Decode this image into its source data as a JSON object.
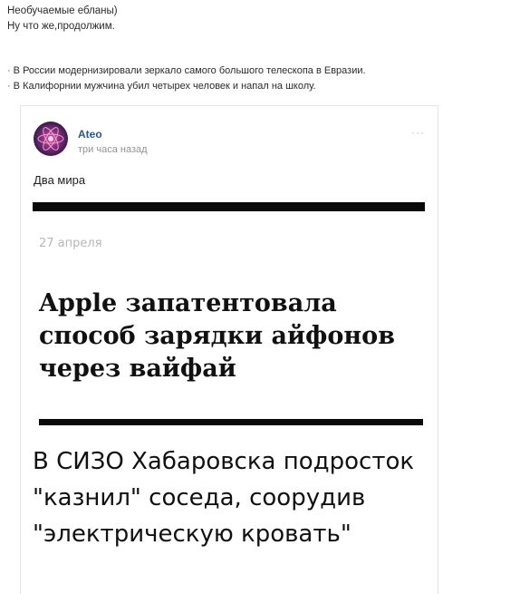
{
  "intro": {
    "line1": "Необучаемые ебланы)",
    "line2": "Ну что же,продолжим."
  },
  "bullets": [
    "В России модернизировали зеркало самого большого телескопа в Евразии.",
    "В Калифорнии мужчина убил четырех человек и напал на школу."
  ],
  "post": {
    "author": "Ateo",
    "time": "три часа назад",
    "more": "···",
    "text": "Два мира",
    "date": "27 апреля",
    "headline1": "Apple запатентовала способ зарядки айфонов через вайфай",
    "headline2": "В СИЗО Хабаровска подросток \"казнил\" соседа, соорудив \"электрическую кровать\""
  },
  "colors": {
    "link": "#2a5885",
    "muted": "#939393",
    "bar": "#0a0a0a"
  }
}
